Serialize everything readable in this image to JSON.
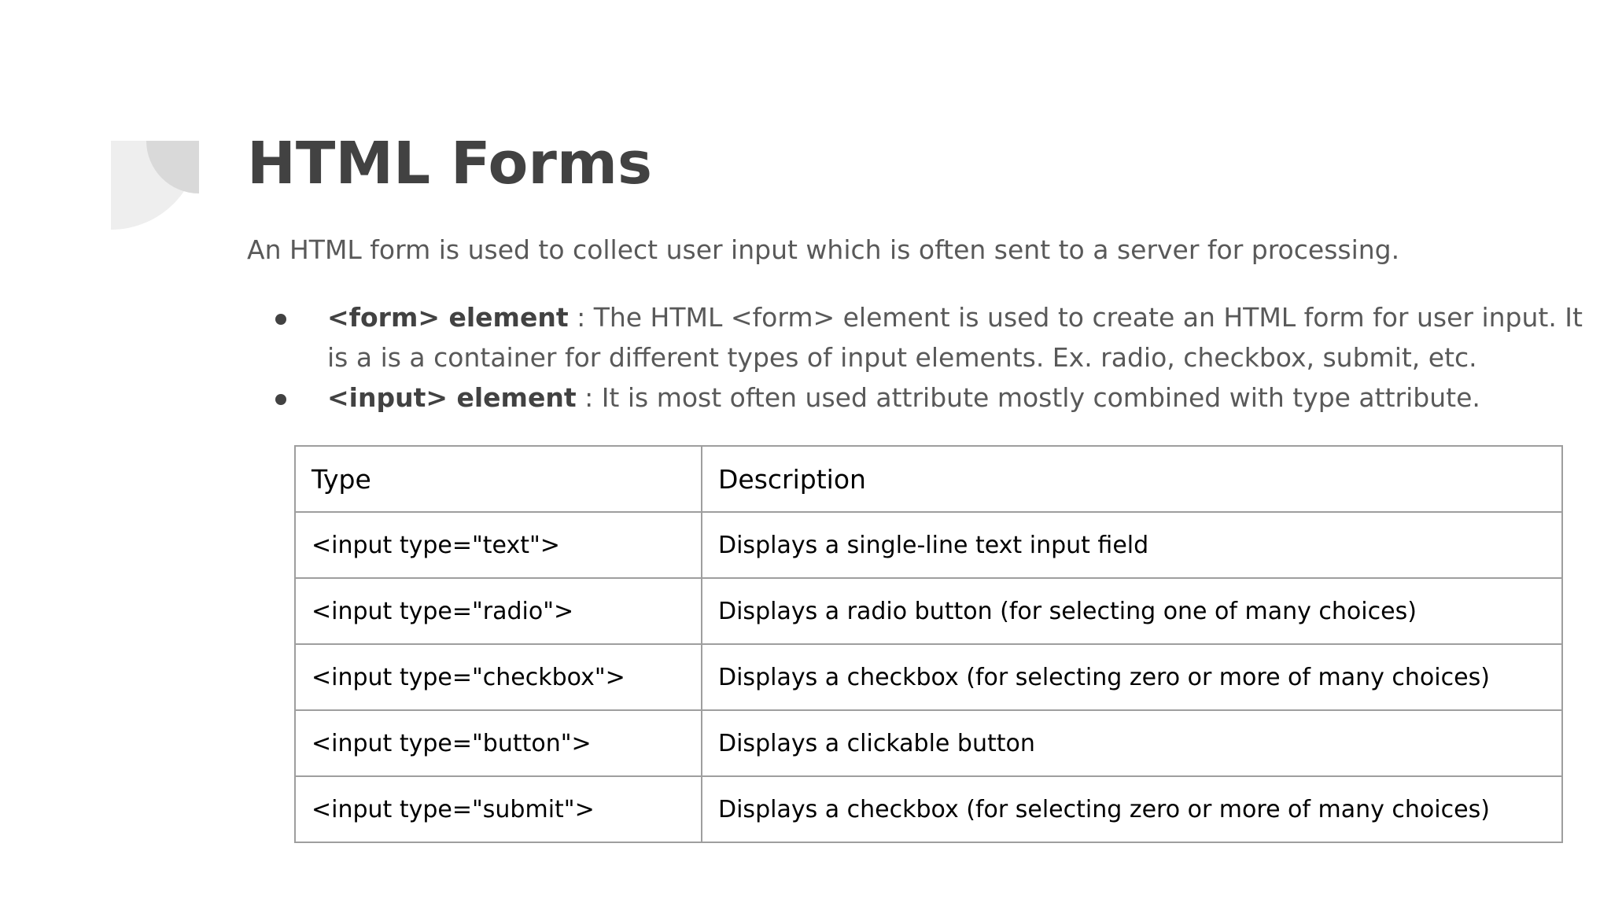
{
  "slide": {
    "title": "HTML Forms",
    "intro": "An HTML form is used to collect user input which is often sent to a server for processing.",
    "bullets": [
      {
        "term": "<form> element",
        "text": " : The HTML <form> element is used to create an HTML form for user input. It is a is a container for different types of input elements. Ex. radio, checkbox, submit, etc."
      },
      {
        "term": "<input> element",
        "text": " : It is most often used attribute mostly combined with type attribute."
      }
    ],
    "table": {
      "headers": [
        "Type",
        "Description"
      ],
      "rows": [
        [
          "<input type=\"text\">",
          "Displays a single-line text input field"
        ],
        [
          "<input type=\"radio\">",
          "Displays a radio button (for selecting one of many choices)"
        ],
        [
          "<input type=\"checkbox\">",
          "Displays a checkbox (for selecting zero or more of many choices)"
        ],
        [
          "<input type=\"button\">",
          "Displays a clickable button"
        ],
        [
          "<input type=\"submit\">",
          "Displays a checkbox (for selecting zero or more of many choices)"
        ]
      ]
    }
  }
}
